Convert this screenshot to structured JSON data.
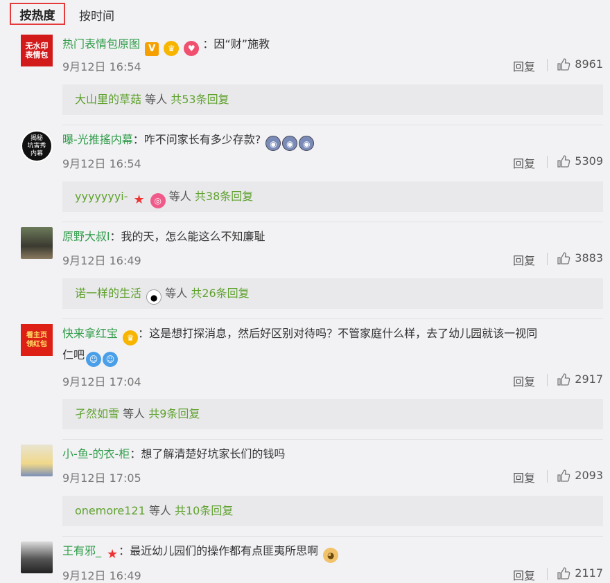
{
  "tabs": {
    "hot": "按热度",
    "time": "按时间"
  },
  "colors": {
    "username": "#2f9c48",
    "reply_user": "#5fa12d",
    "selected_tab_border": "#e63a3a"
  },
  "comments": [
    {
      "avatar_text": "无水印\n表情包",
      "user": "热门表情包原图",
      "badges": [
        "vip-icon",
        "crown-icon",
        "heart-icon"
      ],
      "text": "因“财”施教",
      "text2": "",
      "time": "9月12日 16:54",
      "reply_label": "回复",
      "likes": "8961",
      "reply_user": "大山里的草菇",
      "reply_mid": "等人",
      "reply_count": "共53条回复"
    },
    {
      "avatar_text": "揭秘\n坑害秀\n内幕",
      "user": "曝-光推搖内幕",
      "text": "咋不问家长有多少存款?",
      "text2": "",
      "time": "9月12日 16:54",
      "reply_label": "回复",
      "likes": "5309",
      "reply_user": "yyyyyyyi-",
      "reply_mid": "等人",
      "reply_count": "共38条回复"
    },
    {
      "avatar_text": "",
      "user": "原野大叔l",
      "text": "我的天，怎么能这么不知廉耻",
      "text2": "",
      "time": "9月12日 16:49",
      "reply_label": "回复",
      "likes": "3883",
      "reply_user": "诺一样的生活",
      "reply_mid": "等人",
      "reply_count": "共26条回复"
    },
    {
      "avatar_text": "看主页\n领红包",
      "user": "快来拿红宝",
      "text": "这是想打探消息，然后好区别对待吗？不管家庭什么样，去了幼儿园就该一视同",
      "text2": "仁吧",
      "time": "9月12日 17:04",
      "reply_label": "回复",
      "likes": "2917",
      "reply_user": "孑然如雪",
      "reply_mid": "等人",
      "reply_count": "共9条回复"
    },
    {
      "avatar_text": "",
      "user": "小-鱼-的衣-柜",
      "text": "想了解清楚好坑家长们的钱吗",
      "text2": "",
      "time": "9月12日 17:05",
      "reply_label": "回复",
      "likes": "2093",
      "reply_user": "onemore121",
      "reply_mid": "等人",
      "reply_count": "共10条回复"
    },
    {
      "avatar_text": "",
      "user": "王有邪_",
      "text": "最近幼儿园们的操作都有点匪夷所思啊",
      "text2": "",
      "time": "9月12日 16:49",
      "reply_label": "回复",
      "likes": "2117"
    }
  ]
}
